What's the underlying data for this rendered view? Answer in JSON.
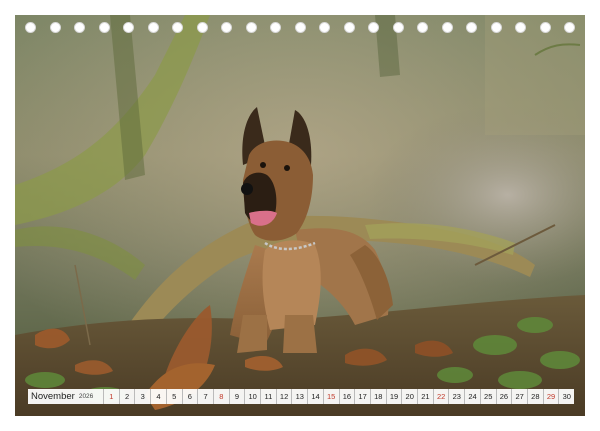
{
  "calendar": {
    "month": "November",
    "year": "2026",
    "days": [
      "1",
      "2",
      "3",
      "4",
      "5",
      "6",
      "7",
      "8",
      "9",
      "10",
      "11",
      "12",
      "13",
      "14",
      "15",
      "16",
      "17",
      "18",
      "19",
      "20",
      "21",
      "22",
      "23",
      "24",
      "25",
      "26",
      "27",
      "28",
      "29",
      "30"
    ],
    "sundays": [
      1,
      8,
      15,
      22,
      29
    ]
  },
  "binding": {
    "hole_count": 23
  },
  "colors": {
    "sunday": "#c0392b",
    "strip_bg": "#ffffff"
  }
}
